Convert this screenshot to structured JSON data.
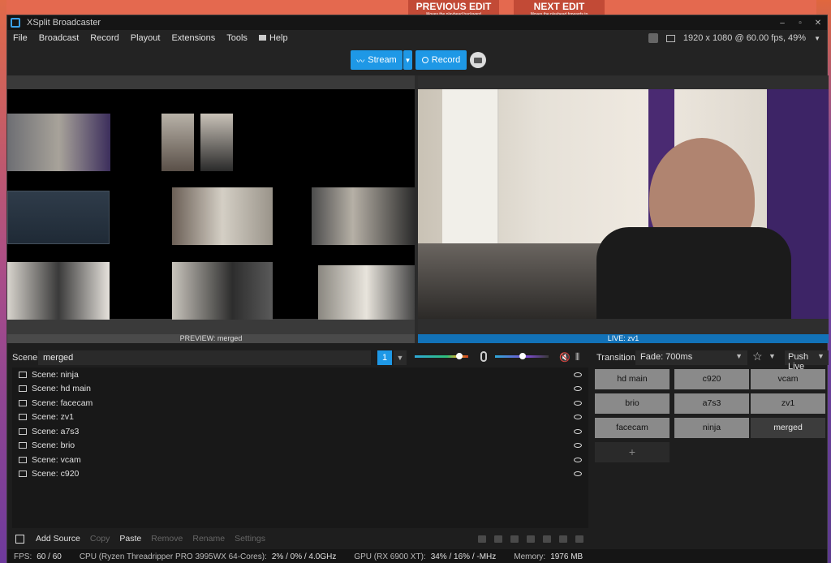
{
  "window": {
    "title": "XSplit Broadcaster",
    "controls": [
      "–",
      "▫",
      "✕"
    ]
  },
  "background": {
    "banners": [
      {
        "label": "PREVIOUS EDIT",
        "sub": "Moves the playhead backward"
      },
      {
        "label": "NEXT EDIT",
        "sub": "Moves the playhead forwards to"
      }
    ]
  },
  "menu": {
    "items": [
      "File",
      "Broadcast",
      "Record",
      "Playout",
      "Extensions",
      "Tools",
      "Help"
    ],
    "resolution": "1920 x 1080 @ 60.00 fps, 49%"
  },
  "toolbar": {
    "stream_label": "Stream",
    "record_label": "Record"
  },
  "preview": {
    "label": "PREVIEW: merged"
  },
  "live": {
    "label": "LIVE: zv1"
  },
  "scene": {
    "label": "Scene",
    "name": "merged",
    "number": "1"
  },
  "volumes": {
    "speaker": 0.88,
    "mic": 0.52
  },
  "scene_list": [
    "Scene: ninja",
    "Scene: hd main",
    "Scene: facecam",
    "Scene: zv1",
    "Scene: a7s3",
    "Scene: brio",
    "Scene: vcam",
    "Scene: c920"
  ],
  "actions": {
    "add_source": "Add Source",
    "copy": "Copy",
    "paste": "Paste",
    "remove": "Remove",
    "rename": "Rename",
    "settings": "Settings"
  },
  "transition": {
    "label": "Transition",
    "value": "Fade: 700ms",
    "push_live": "Push Live"
  },
  "scene_buttons": [
    "hd main",
    "c920",
    "vcam",
    "brio",
    "a7s3",
    "zv1",
    "facecam",
    "ninja",
    "merged"
  ],
  "add_scene": "+",
  "status": {
    "fps_label": "FPS:",
    "fps": "60 / 60",
    "cpu_label": "CPU (Ryzen Threadripper PRO 3995WX 64-Cores):",
    "cpu": "2% / 0% / 4.0GHz",
    "gpu_label": "GPU (RX 6900 XT):",
    "gpu": "34% / 16% / -MHz",
    "mem_label": "Memory:",
    "mem": "1976 MB"
  },
  "colors": {
    "accent": "#1e98e6",
    "live_bar": "#1272b8"
  }
}
